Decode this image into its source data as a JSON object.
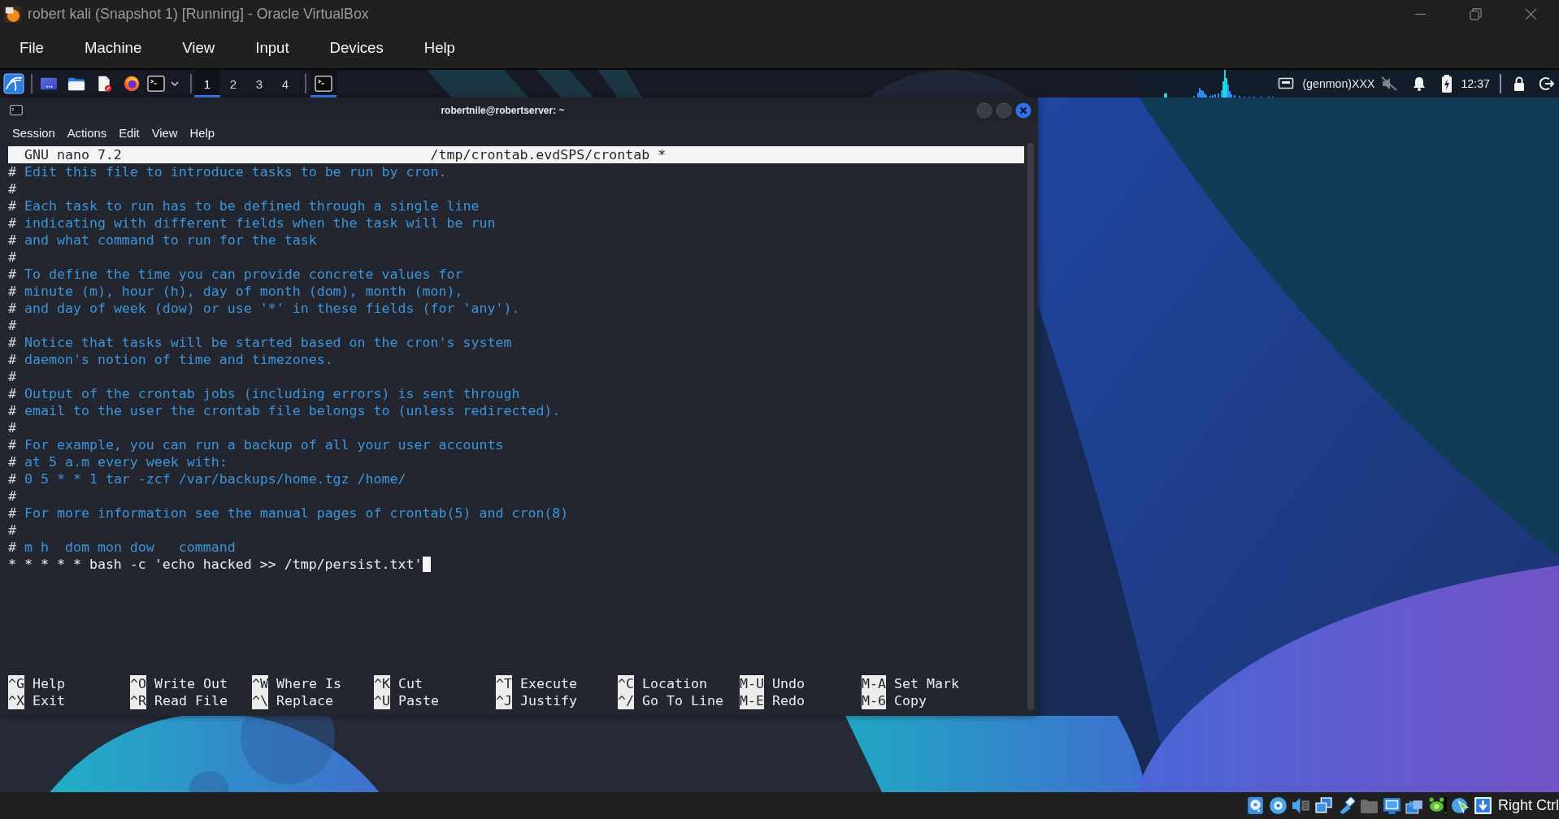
{
  "window": {
    "title": "robert kali (Snapshot 1) [Running] - Oracle VirtualBox"
  },
  "menu_bar": [
    "File",
    "Machine",
    "View",
    "Input",
    "Devices",
    "Help"
  ],
  "panel": {
    "workspaces": [
      {
        "label": "1",
        "selected": true
      },
      {
        "label": "2",
        "selected": false
      },
      {
        "label": "3",
        "selected": false
      },
      {
        "label": "4",
        "selected": false
      }
    ],
    "tasks": [
      {
        "kind": "terminal",
        "selected": true
      }
    ],
    "tray": {
      "genmon": "(genmon)XXX",
      "muted": true,
      "clock": "12:37"
    }
  },
  "terminal": {
    "title": "robertnile@robertserver: ~",
    "menu": [
      "Session",
      "Actions",
      "Edit",
      "View",
      "Help"
    ],
    "nano": {
      "version": "GNU nano 7.2",
      "file": "/tmp/crontab.evdSPS/crontab *",
      "lines": [
        {
          "kind": "comment",
          "marker": "#",
          "text": " Edit this file to introduce tasks to be run by cron.",
          "cursor": false
        },
        {
          "kind": "comment",
          "marker": "#",
          "cursor": false
        },
        {
          "kind": "comment",
          "marker": "#",
          "text": " Each task to run has to be defined through a single line",
          "cursor": false
        },
        {
          "kind": "comment",
          "marker": "#",
          "text": " indicating with different fields when the task will be run",
          "cursor": false
        },
        {
          "kind": "comment",
          "marker": "#",
          "text": " and what command to run for the task",
          "cursor": false
        },
        {
          "kind": "comment",
          "marker": "#",
          "cursor": false
        },
        {
          "kind": "comment",
          "marker": "#",
          "text": " To define the time you can provide concrete values for",
          "cursor": false
        },
        {
          "kind": "comment",
          "marker": "#",
          "text": " minute (m), hour (h), day of month (dom), month (mon),",
          "cursor": false
        },
        {
          "kind": "comment",
          "marker": "#",
          "text": " and day of week (dow) or use '*' in these fields (for 'any').",
          "cursor": false
        },
        {
          "kind": "comment",
          "marker": "#",
          "cursor": false
        },
        {
          "kind": "comment",
          "marker": "#",
          "text": " Notice that tasks will be started based on the cron's system",
          "cursor": false
        },
        {
          "kind": "comment",
          "marker": "#",
          "text": " daemon's notion of time and timezones.",
          "cursor": false
        },
        {
          "kind": "comment",
          "marker": "#",
          "cursor": false
        },
        {
          "kind": "comment",
          "marker": "#",
          "text": " Output of the crontab jobs (including errors) is sent through",
          "cursor": false
        },
        {
          "kind": "comment",
          "marker": "#",
          "text": " email to the user the crontab file belongs to (unless redirected).",
          "cursor": false
        },
        {
          "kind": "comment",
          "marker": "#",
          "cursor": false
        },
        {
          "kind": "comment",
          "marker": "#",
          "text": " For example, you can run a backup of all your user accounts",
          "cursor": false
        },
        {
          "kind": "comment",
          "marker": "#",
          "text": " at 5 a.m every week with:",
          "cursor": false
        },
        {
          "kind": "comment",
          "marker": "#",
          "text": " 0 5 * * 1 tar -zcf /var/backups/home.tgz /home/",
          "cursor": false
        },
        {
          "kind": "comment",
          "marker": "#",
          "cursor": false
        },
        {
          "kind": "comment",
          "marker": "#",
          "text": " For more information see the manual pages of crontab(5) and cron(8)",
          "cursor": false
        },
        {
          "kind": "comment",
          "marker": "#",
          "cursor": false
        },
        {
          "kind": "comment",
          "marker": "#",
          "text": " m h  dom mon dow   command",
          "cursor": false
        },
        {
          "kind": "entry",
          "text": "* * * * * bash -c 'echo hacked >> /tmp/persist.txt'",
          "cursor": true
        }
      ],
      "shortcut_rows": [
        [
          {
            "key": "^G",
            "label": "Help"
          },
          {
            "key": "^O",
            "label": "Write Out"
          },
          {
            "key": "^W",
            "label": "Where Is"
          },
          {
            "key": "^K",
            "label": "Cut"
          },
          {
            "key": "^T",
            "label": "Execute"
          },
          {
            "key": "^C",
            "label": "Location"
          },
          {
            "key": "M-U",
            "label": "Undo"
          },
          {
            "key": "M-A",
            "label": "Set Mark"
          }
        ],
        [
          {
            "key": "^X",
            "label": "Exit"
          },
          {
            "key": "^R",
            "label": "Read File"
          },
          {
            "key": "^\\",
            "label": "Replace"
          },
          {
            "key": "^U",
            "label": "Paste"
          },
          {
            "key": "^J",
            "label": "Justify"
          },
          {
            "key": "^/",
            "label": "Go To Line"
          },
          {
            "key": "M-E",
            "label": "Redo"
          },
          {
            "key": "M-6",
            "label": "Copy"
          }
        ]
      ]
    }
  },
  "status_bar": {
    "host_key": "Right Ctrl"
  }
}
